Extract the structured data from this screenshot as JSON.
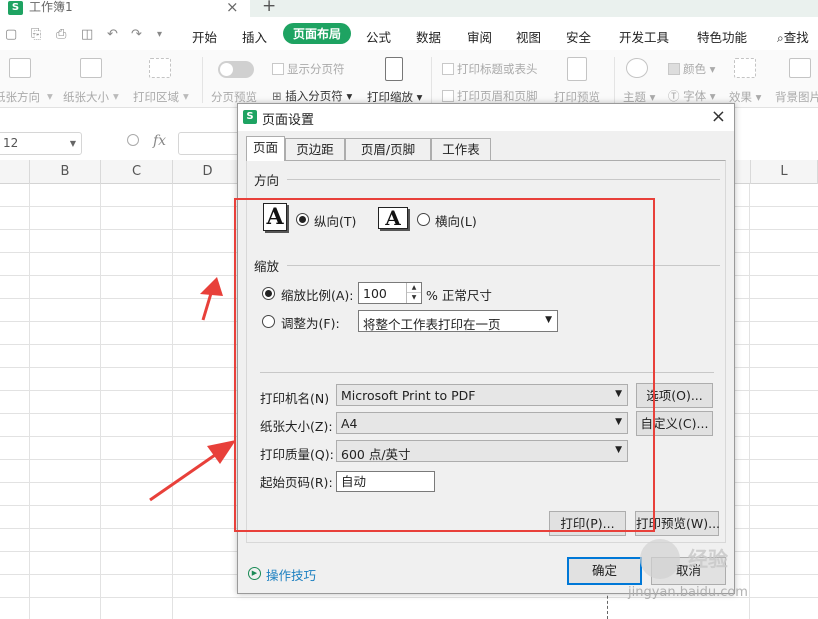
{
  "window": {
    "book_tab_title": "工作簿1",
    "logo_letter": "S",
    "tab_close_glyph": "×",
    "tab_add_glyph": "+"
  },
  "menu": {
    "tabs": [
      "开始",
      "插入",
      "页面布局",
      "公式",
      "数据",
      "审阅",
      "视图",
      "安全",
      "开发工具",
      "特色功能"
    ],
    "active_tab": "页面布局",
    "search_label": "查找"
  },
  "ribbon": {
    "paper_direction": "纸张方向",
    "paper_size": "纸张大小",
    "print_area": "打印区域",
    "show_page_break": "显示分页符",
    "page_break_preview": "分页预览",
    "insert_page_break": "插入分页符",
    "print_scale": "打印缩放",
    "print_titles": "打印标题或表头",
    "print_header_footer": "打印页眉和页脚",
    "print_preview": "打印预览",
    "theme": "主题",
    "colors": "颜色",
    "fonts": "字体",
    "effects": "效果",
    "background": "背景图片"
  },
  "formula_bar": {
    "cell_ref": "12",
    "fx": "fx"
  },
  "grid": {
    "columns": [
      "B",
      "C",
      "D",
      "L"
    ]
  },
  "dialog": {
    "title": "页面设置",
    "close_glyph": "×",
    "tabs": [
      "页面",
      "页边距",
      "页眉/页脚",
      "工作表"
    ],
    "active_tab": "页面",
    "orientation": {
      "group_label": "方向",
      "portrait_label": "纵向(T)",
      "landscape_label": "横向(L)",
      "icon_letter": "A",
      "selected": "portrait"
    },
    "scaling": {
      "group_label": "缩放",
      "scale_label": "缩放比例(A):",
      "scale_value": "100",
      "scale_suffix": "% 正常尺寸",
      "fit_label": "调整为(F):",
      "fit_option": "将整个工作表打印在一页",
      "selected": "scale"
    },
    "printer": {
      "printer_label": "打印机名(N)",
      "printer_value": "Microsoft Print to PDF",
      "options_button": "选项(O)...",
      "paper_label": "纸张大小(Z):",
      "paper_value": "A4",
      "custom_button": "自定义(C)...",
      "quality_label": "打印质量(Q):",
      "quality_value": "600 点/英寸",
      "first_page_label": "起始页码(R):",
      "first_page_value": "自动"
    },
    "print_button": "打印(P)...",
    "preview_button": "打印预览(W)...",
    "tips_link": "操作技巧",
    "ok_button": "确定",
    "cancel_button": "取消"
  },
  "watermark": {
    "brand": "经验",
    "url": "jingyan.baidu.com"
  },
  "colors": {
    "accent_green": "#1ea362",
    "annotation_red": "#e8403a",
    "link_blue": "#1a7fc0"
  }
}
